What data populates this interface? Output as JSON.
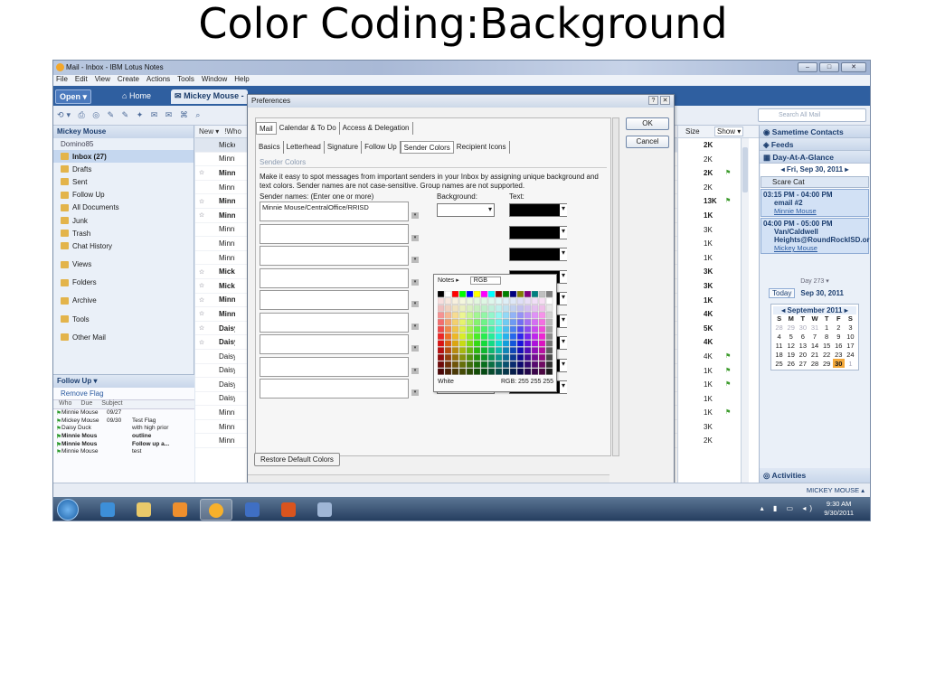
{
  "slide": {
    "title": "Color Coding:Background"
  },
  "window": {
    "title": "Mail - Inbox - IBM Lotus Notes",
    "controls": [
      "–",
      "□",
      "✕"
    ]
  },
  "menu": [
    "File",
    "Edit",
    "View",
    "Create",
    "Actions",
    "Tools",
    "Window",
    "Help"
  ],
  "tabs": {
    "open": "Open",
    "home": "Home",
    "mickey": "Mickey Mouse -"
  },
  "search": {
    "placeholder": "Search All Mail"
  },
  "nav": {
    "owner": "Mickey Mouse",
    "domain": "Domino85",
    "items": [
      "Inbox (27)",
      "Drafts",
      "Sent",
      "Follow Up",
      "All Documents",
      "Junk",
      "Trash",
      "Chat History"
    ],
    "groups": [
      "Views",
      "Folders",
      "Archive",
      "Tools",
      "Other Mail"
    ]
  },
  "followup": {
    "title": "Follow Up",
    "remove": "Remove Flag",
    "cols": [
      "Who",
      "Due",
      "Subject"
    ],
    "rows": [
      {
        "who": "Minnie Mouse",
        "due": "09/27",
        "subject": ""
      },
      {
        "who": "Mickey Mouse",
        "due": "09/30",
        "subject": "Test Flag"
      },
      {
        "who": "Daisy Duck",
        "due": "",
        "subject": "with high prior"
      },
      {
        "who": "Minnie Mous",
        "due": "",
        "subject": "outline"
      },
      {
        "who": "Minnie Mous",
        "due": "",
        "subject": "Follow up a..."
      },
      {
        "who": "Minnie Mouse",
        "due": "",
        "subject": "test"
      }
    ]
  },
  "inbox": {
    "new_label": "New",
    "who_label": "!Who",
    "rows": [
      {
        "who": "Mickey",
        "bold": false
      },
      {
        "who": "Minnie",
        "bold": false
      },
      {
        "who": "Minnie",
        "bold": true
      },
      {
        "who": "Minnie",
        "bold": false
      },
      {
        "who": "Minnie",
        "bold": true
      },
      {
        "who": "Minnie",
        "bold": true
      },
      {
        "who": "Minnie",
        "bold": false
      },
      {
        "who": "Minnie",
        "bold": false
      },
      {
        "who": "Minnie",
        "bold": false
      },
      {
        "who": "Mickey",
        "bold": true
      },
      {
        "who": "Mickey",
        "bold": true
      },
      {
        "who": "Minnie",
        "bold": true
      },
      {
        "who": "Minnie",
        "bold": true
      },
      {
        "who": "Daisy",
        "bold": true
      },
      {
        "who": "Daisy",
        "bold": true
      },
      {
        "who": "Daisy",
        "bold": false
      },
      {
        "who": "Daisy",
        "bold": false
      },
      {
        "who": "Daisy",
        "bold": false
      },
      {
        "who": "Daisy",
        "bold": false
      },
      {
        "who": "Minnie",
        "bold": false
      },
      {
        "who": "Minnie",
        "bold": false
      },
      {
        "who": "Minnie",
        "bold": false
      }
    ],
    "size_label": "Size",
    "show_label": "Show",
    "sizes": [
      {
        "v": "2K",
        "b": true
      },
      {
        "v": "2K",
        "b": false
      },
      {
        "v": "2K",
        "b": true
      },
      {
        "v": "2K",
        "b": false
      },
      {
        "v": "13K",
        "b": true
      },
      {
        "v": "1K",
        "b": true
      },
      {
        "v": "3K",
        "b": false
      },
      {
        "v": "1K",
        "b": false
      },
      {
        "v": "1K",
        "b": false
      },
      {
        "v": "3K",
        "b": true
      },
      {
        "v": "3K",
        "b": true
      },
      {
        "v": "1K",
        "b": true
      },
      {
        "v": "4K",
        "b": true
      },
      {
        "v": "5K",
        "b": true
      },
      {
        "v": "4K",
        "b": true
      },
      {
        "v": "4K",
        "b": false
      },
      {
        "v": "1K",
        "b": false
      },
      {
        "v": "1K",
        "b": false
      },
      {
        "v": "1K",
        "b": false
      },
      {
        "v": "1K",
        "b": false
      },
      {
        "v": "3K",
        "b": false
      },
      {
        "v": "2K",
        "b": false
      }
    ]
  },
  "sidebar": {
    "sametime": "Sametime Contacts",
    "feeds": "Feeds",
    "dayataglance": "Day-At-A-Glance",
    "date": "Fri, Sep 30, 2011",
    "scare": "Scare Cat",
    "appts": [
      {
        "time": "03:15 PM - 04:00 PM",
        "body": "email #2",
        "who": "Minnie Mouse"
      },
      {
        "time": "04:00 PM - 05:00 PM",
        "body": "Van/Caldwell Heights@RoundRockISD.org",
        "who": "Mickey Mouse"
      }
    ],
    "day_of_year": "Day 273",
    "today_btn": "Today",
    "today_date": "Sep 30, 2011",
    "month": "September 2011",
    "weekdays": [
      "S",
      "M",
      "T",
      "W",
      "T",
      "F",
      "S"
    ],
    "weeks": [
      [
        "28",
        "29",
        "30",
        "31",
        "1",
        "2",
        "3"
      ],
      [
        "4",
        "5",
        "6",
        "7",
        "8",
        "9",
        "10"
      ],
      [
        "11",
        "12",
        "13",
        "14",
        "15",
        "16",
        "17"
      ],
      [
        "18",
        "19",
        "20",
        "21",
        "22",
        "23",
        "24"
      ],
      [
        "25",
        "26",
        "27",
        "28",
        "29",
        "30",
        "1"
      ]
    ],
    "activities": "Activities"
  },
  "dialog": {
    "title": "Preferences",
    "tabs_top": [
      "Mail",
      "Calendar & To Do",
      "Access & Delegation"
    ],
    "tabs_sub": [
      "Basics",
      "Letterhead",
      "Signature",
      "Follow Up",
      "Sender Colors",
      "Recipient Icons"
    ],
    "section": "Sender Colors",
    "desc": "Make it easy to spot messages from important senders in your Inbox by assigning unique background and text colors.  Sender names are not case-sensitive. Group names are not supported.",
    "col_names": "Sender names: (Enter one or more)",
    "col_bg": "Background:",
    "col_text": "Text:",
    "first_sender": "Minnie Mouse/CentralOffice/RRISD",
    "ok": "OK",
    "cancel": "Cancel",
    "restore": "Restore Default Colors",
    "help": "?",
    "close": "✕"
  },
  "palette": {
    "tab_notes": "Notes",
    "tab_rgb": "RGB",
    "swatch_name": "White",
    "rgb_label": "RGB:",
    "rgb": [
      "255",
      "255",
      "255"
    ]
  },
  "status": {
    "user": "MICKEY MOUSE"
  },
  "taskbar": {
    "time": "9:30 AM",
    "date": "9/30/2011"
  }
}
